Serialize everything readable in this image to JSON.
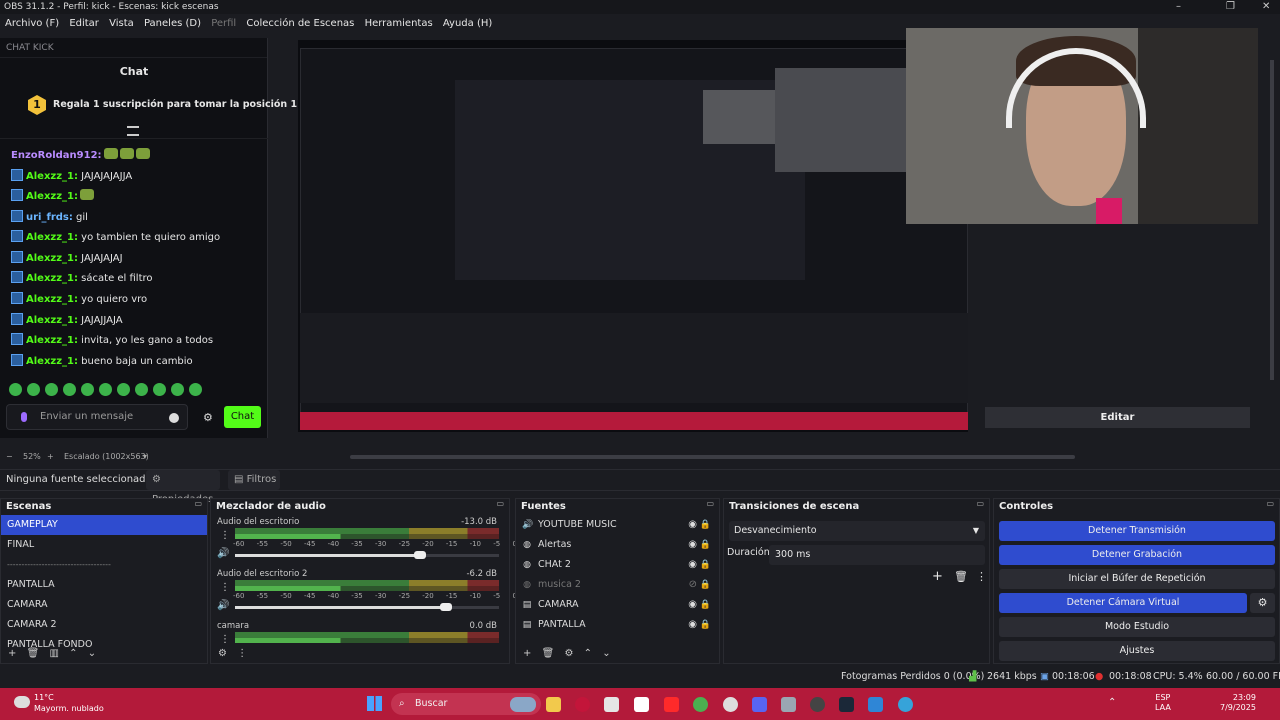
{
  "window": {
    "title": "OBS 31.1.2 - Perfil: kick - Escenas: kick escenas",
    "minimize": "–",
    "maximize": "❐",
    "close": "✕"
  },
  "menu": [
    "Archivo (F)",
    "Editar",
    "Vista",
    "Paneles (D)",
    "Perfil",
    "Colección de Escenas",
    "Herramientas",
    "Ayuda (H)"
  ],
  "chat_dock": {
    "dock_title": "CHAT KICK",
    "title": "Chat",
    "goal_number": "1",
    "goal_text": "Regala 1 suscripción para tomar la posición 1",
    "messages": [
      {
        "user": "EnzoRoldan912:",
        "text": "",
        "emotes": 3
      },
      {
        "user": "Alexzz_1:",
        "text": " JAJAJAJAJJA"
      },
      {
        "user": "Alexzz_1:",
        "text": "",
        "emotes": 1
      },
      {
        "user": "uri_frds:",
        "text": " gil"
      },
      {
        "user": "Alexzz_1:",
        "text": " yo tambien te quiero amigo"
      },
      {
        "user": "Alexzz_1:",
        "text": " JAJAJAJAJ"
      },
      {
        "user": "Alexzz_1:",
        "text": " sácate el filtro"
      },
      {
        "user": "Alexzz_1:",
        "text": " yo quiero vro"
      },
      {
        "user": "Alexzz_1:",
        "text": " JAJAJJAJA"
      },
      {
        "user": "Alexzz_1:",
        "text": " invita, yo les gano a todos"
      },
      {
        "user": "Alexzz_1:",
        "text": " bueno baja un cambio"
      }
    ],
    "input_placeholder": "Enviar un mensaje",
    "send_label": "Chat"
  },
  "preview": {
    "edit_label": "Editar"
  },
  "zoom": {
    "minus": "−",
    "percent": "52%",
    "plus": "+",
    "mode": "Escalado (1002x563)",
    "caret": "▾"
  },
  "source_toolbar": {
    "none": "Ninguna fuente seleccionad",
    "properties": "⚙ Propiedades",
    "filters": "▤ Filtros"
  },
  "scenes": {
    "title": "Escenas",
    "items": [
      "GAMEPLAY",
      "FINAL",
      "------------------------------------",
      "PANTALLA",
      "CAMARA",
      "CAMARA 2",
      "PANTALLA FONDO"
    ],
    "selected": 0
  },
  "mixer": {
    "title": "Mezclador de audio",
    "ticks": "-60 -55 -50 -45 -40 -35 -30 -25 -20 -15 -10 -5 0",
    "tracks": [
      {
        "name": "Audio del escritorio",
        "db": "-13.0 dB",
        "volume": 0.7
      },
      {
        "name": "Audio del escritorio 2",
        "db": "-6.2 dB",
        "volume": 0.8
      },
      {
        "name": "camara",
        "db": "0.0 dB",
        "volume": 1.0
      }
    ]
  },
  "sources": {
    "title": "Fuentes",
    "items": [
      {
        "name": "YOUTUBE MUSIC",
        "icon": "🔊",
        "visible": true
      },
      {
        "name": "Alertas",
        "icon": "◍",
        "visible": true
      },
      {
        "name": "CHAt 2",
        "icon": "◍",
        "visible": true
      },
      {
        "name": "musica 2",
        "icon": "◍",
        "visible": false
      },
      {
        "name": "CAMARA",
        "icon": "▤",
        "visible": true
      },
      {
        "name": "PANTALLA",
        "icon": "▤",
        "visible": true
      }
    ]
  },
  "transitions": {
    "title": "Transiciones de escena",
    "selected": "Desvanecimiento",
    "duration_label": "Duración",
    "duration": "300 ms"
  },
  "controls": {
    "title": "Controles",
    "stop_stream": "Detener Transmisión",
    "stop_record": "Detener Grabación",
    "replay_buffer": "Iniciar el Búfer de Repetición",
    "stop_vcam": "Detener Cámara Virtual",
    "studio_mode": "Modo Estudio",
    "settings": "Ajustes"
  },
  "status": {
    "dropped": "Fotogramas Perdidos 0 (0.0%)",
    "bitrate": "2641 kbps",
    "stream_time": "00:18:06",
    "rec_time": "00:18:08",
    "cpu": "CPU: 5.4%",
    "fps": "60.00 / 60.00 FPS"
  },
  "taskbar": {
    "temp": "11°C",
    "condition": "Mayorm. nublado",
    "search": "Buscar",
    "lang1": "ESP",
    "lang2": "LAA",
    "time": "23:09",
    "date": "7/9/2025"
  },
  "colors": {
    "accent": "#2f4ccf",
    "kick_green": "#53fc18",
    "taskbar": "#b31a3a"
  }
}
